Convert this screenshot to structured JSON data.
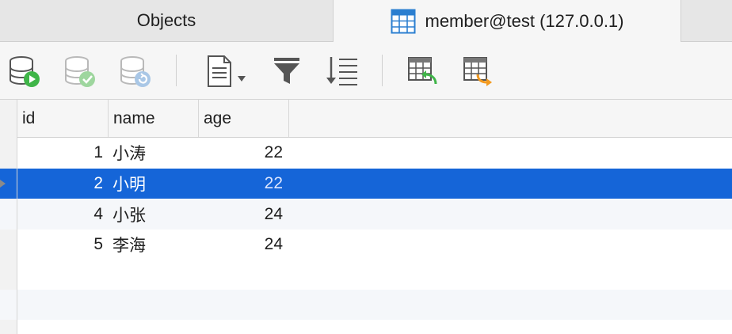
{
  "tabs": {
    "objects": "Objects",
    "member": "member@test (127.0.0.1)"
  },
  "toolbar": {
    "icons": [
      "db-run-icon",
      "db-commit-icon",
      "db-refresh-icon",
      "document-icon",
      "filter-icon",
      "sort-icon",
      "import-table-icon",
      "export-table-icon"
    ]
  },
  "table": {
    "columns": [
      "id",
      "name",
      "age"
    ],
    "rows": [
      {
        "id": "1",
        "name": "小涛",
        "age": "22"
      },
      {
        "id": "2",
        "name": "小明",
        "age": "22"
      },
      {
        "id": "4",
        "name": "小张",
        "age": "24"
      },
      {
        "id": "5",
        "name": "李海",
        "age": "24"
      }
    ],
    "selected_row": 1
  },
  "colors": {
    "selection": "#1565d8",
    "run_green": "#3fb548",
    "arrow_orange": "#f39a1f"
  }
}
